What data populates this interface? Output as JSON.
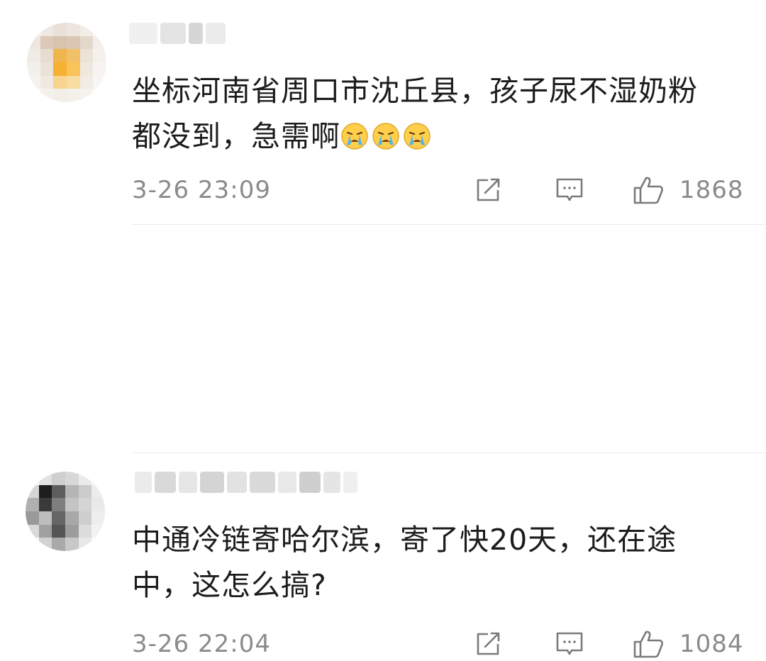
{
  "comments": [
    {
      "text_line1": "坐标河南省周口市沈丘县，孩子尿不湿奶粉",
      "text_line2": "都没到，急需啊",
      "emojis": [
        "crying-emoji",
        "crying-emoji",
        "crying-emoji"
      ],
      "timestamp": "3-26 23:09",
      "likes": "1868"
    },
    {
      "text_line1": "中通冷链寄哈尔滨，寄了快20天，还在途",
      "text_line2": "中，这怎么搞?",
      "timestamp": "3-26 22:04",
      "likes": "1084"
    }
  ],
  "icons": {
    "share": "share-icon",
    "reply": "comment-icon",
    "like": "thumbs-up-icon"
  },
  "colors": {
    "meta_text": "#8b8b8b",
    "body_text": "#1c1c1c",
    "divider": "#ececec"
  }
}
